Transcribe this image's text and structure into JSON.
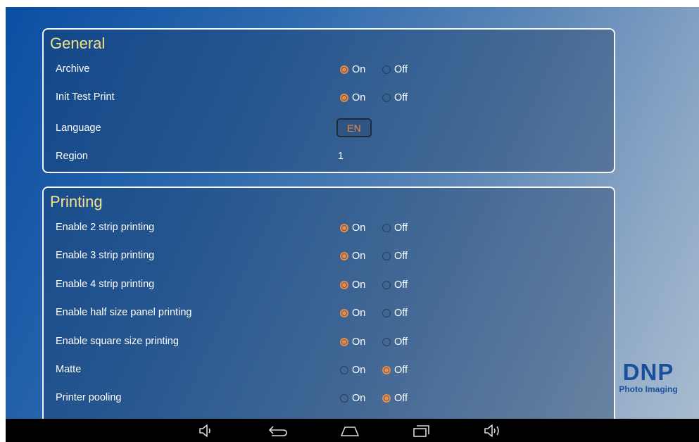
{
  "general": {
    "title": "General",
    "archive": {
      "label": "Archive",
      "on_label": "On",
      "off_label": "Off",
      "value": "on"
    },
    "init_test_print": {
      "label": "Init Test Print",
      "on_label": "On",
      "off_label": "Off",
      "value": "on"
    },
    "language": {
      "label": "Language",
      "value": "EN"
    },
    "region": {
      "label": "Region",
      "value": "1"
    }
  },
  "printing": {
    "title": "Printing",
    "rows": [
      {
        "label": "Enable 2 strip printing",
        "on_label": "On",
        "off_label": "Off",
        "value": "on"
      },
      {
        "label": "Enable 3 strip printing",
        "on_label": "On",
        "off_label": "Off",
        "value": "on"
      },
      {
        "label": "Enable 4 strip printing",
        "on_label": "On",
        "off_label": "Off",
        "value": "on"
      },
      {
        "label": "Enable half size panel printing",
        "on_label": "On",
        "off_label": "Off",
        "value": "on"
      },
      {
        "label": "Enable square size printing",
        "on_label": "On",
        "off_label": "Off",
        "value": "on"
      },
      {
        "label": "Matte",
        "on_label": "On",
        "off_label": "Off",
        "value": "off"
      },
      {
        "label": "Printer pooling",
        "on_label": "On",
        "off_label": "Off",
        "value": "off"
      }
    ]
  },
  "logo": {
    "main": "DNP",
    "sub": "Photo Imaging"
  },
  "navbar": {
    "icons": [
      "volume-down-icon",
      "back-icon",
      "home-icon",
      "recent-apps-icon",
      "volume-up-icon"
    ]
  },
  "colors": {
    "accent": "#f08a3c",
    "title": "#f4e28a",
    "brand": "#1b4f9c"
  }
}
